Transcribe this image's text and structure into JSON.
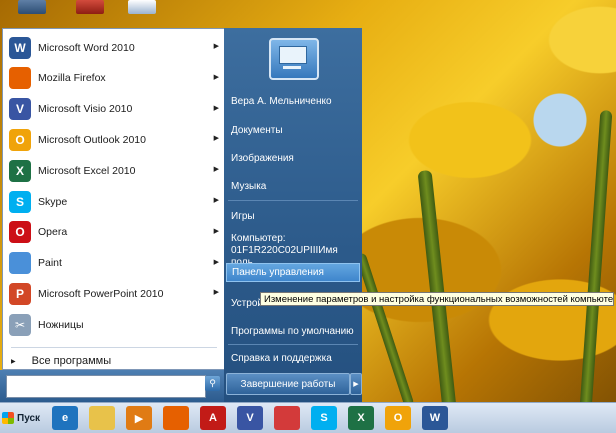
{
  "start_menu": {
    "programs": [
      {
        "label": "Microsoft Word 2010",
        "icon": "word-icon",
        "glyph": "W",
        "color": "#2b5797"
      },
      {
        "label": "Mozilla Firefox",
        "icon": "firefox-icon",
        "glyph": "",
        "color": "#e66000"
      },
      {
        "label": "Microsoft Visio 2010",
        "icon": "visio-icon",
        "glyph": "V",
        "color": "#3955a3"
      },
      {
        "label": "Microsoft Outlook 2010",
        "icon": "outlook-icon",
        "glyph": "O",
        "color": "#f0a30a"
      },
      {
        "label": "Microsoft Excel 2010",
        "icon": "excel-icon",
        "glyph": "X",
        "color": "#1e7145"
      },
      {
        "label": "Skype",
        "icon": "skype-icon",
        "glyph": "S",
        "color": "#00aff0"
      },
      {
        "label": "Opera",
        "icon": "opera-icon",
        "glyph": "O",
        "color": "#cc0f16"
      },
      {
        "label": "Paint",
        "icon": "paint-icon",
        "glyph": "",
        "color": "#4a90d9"
      },
      {
        "label": "Microsoft PowerPoint 2010",
        "icon": "powerpoint-icon",
        "glyph": "P",
        "color": "#d24726"
      },
      {
        "label": "Ножницы",
        "icon": "scissors-icon",
        "glyph": "✂",
        "color": "#8aa0b8"
      }
    ],
    "all_programs": "Все программы",
    "search": {
      "value": "",
      "placeholder": ""
    },
    "right": {
      "user": "Вера А. Мельниченко",
      "documents": "Документы",
      "pictures": "Изображения",
      "music": "Музыка",
      "games": "Игры",
      "computer_line1": "Компьютер:",
      "computer_line2": "01F1R220C02UPIIIИмя поль...",
      "control_panel": "Панель управления",
      "devices": "Устрой",
      "default_programs": "Программы по умолчанию",
      "help": "Справка и поддержка"
    },
    "shutdown": "Завершение работы"
  },
  "tooltip": "Изменение параметров и настройка функциональных возможностей компьютера.",
  "taskbar": {
    "start_label": "Пуск",
    "pinned": [
      {
        "icon": "ie-icon",
        "glyph": "e",
        "color": "#1e73be"
      },
      {
        "icon": "explorer-icon",
        "glyph": "",
        "color": "#e8c24a"
      },
      {
        "icon": "media-player-icon",
        "glyph": "▶",
        "color": "#e07b14"
      },
      {
        "icon": "firefox-icon",
        "glyph": "",
        "color": "#e66000"
      },
      {
        "icon": "acrobat-icon",
        "glyph": "A",
        "color": "#c21b17"
      },
      {
        "icon": "visio-icon",
        "glyph": "V",
        "color": "#3955a3"
      },
      {
        "icon": "paint-icon",
        "glyph": "",
        "color": "#d33a3a"
      },
      {
        "icon": "skype-icon",
        "glyph": "S",
        "color": "#00aff0"
      },
      {
        "icon": "excel-icon",
        "glyph": "X",
        "color": "#1e7145"
      },
      {
        "icon": "outlook-icon",
        "glyph": "O",
        "color": "#f0a30a"
      },
      {
        "icon": "word-icon",
        "glyph": "W",
        "color": "#2b5797"
      }
    ]
  }
}
